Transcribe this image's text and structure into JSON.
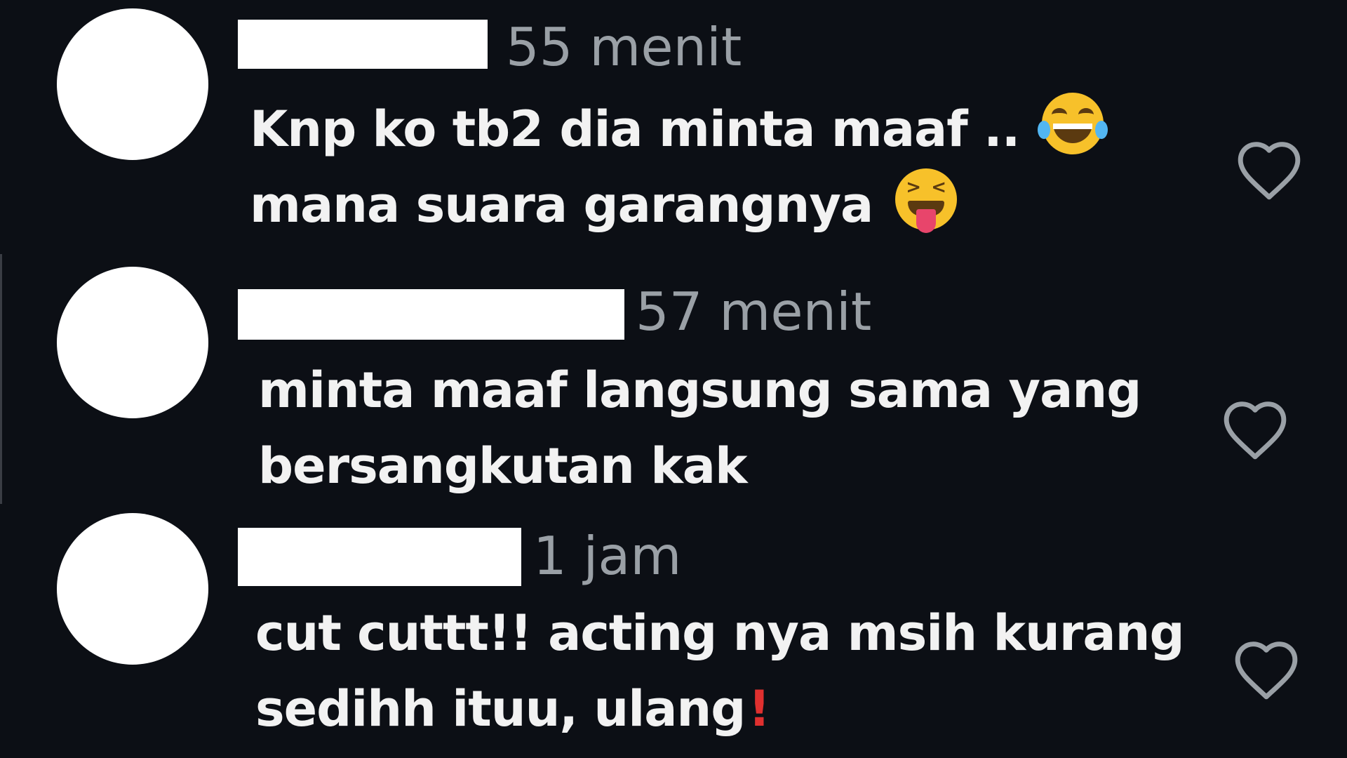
{
  "comments": [
    {
      "time": "55 menit",
      "lines": [
        "Knp ko tb2 dia minta maaf ..",
        "mana suara garangnya"
      ],
      "line_emojis": [
        "face-with-tears-of-joy-icon",
        "squinting-face-with-tongue-icon"
      ]
    },
    {
      "time": "57 menit",
      "lines": [
        "minta maaf langsung sama yang",
        "bersangkutan kak"
      ]
    },
    {
      "time": "1 jam",
      "lines": [
        "cut cuttt!! acting nya msih kurang",
        "sedihh ituu, ulang"
      ],
      "line_end_mark": "!"
    }
  ],
  "colors": {
    "background": "#0c0f15",
    "text": "#f2f2f2",
    "time": "#9aa0a6",
    "heart_outline": "#9aa0a6",
    "exclamation": "#e0302f"
  }
}
